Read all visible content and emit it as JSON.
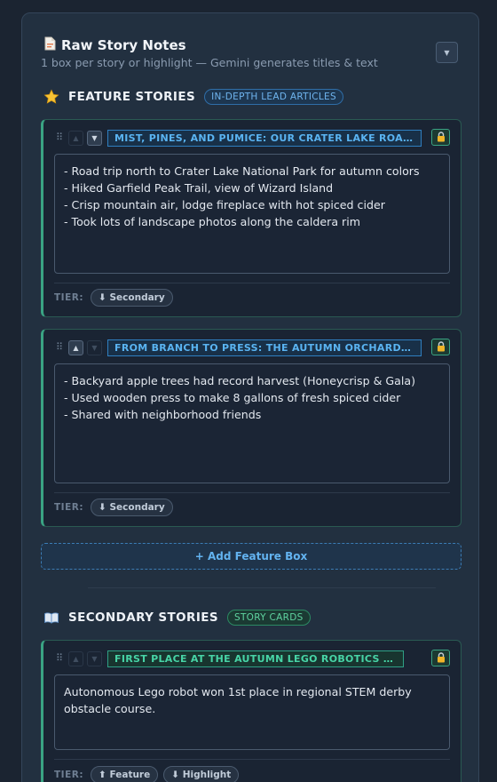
{
  "panel": {
    "title": "Raw Story Notes",
    "subtitle": "1 box per story or highlight — Gemini generates titles & text",
    "icon": "document-icon"
  },
  "feature_section": {
    "icon": "star-icon",
    "title": "FEATURE STORIES",
    "badge": "IN-DEPTH LEAD ARTICLES",
    "cards": [
      {
        "title": "MIST, PINES, AND PUMICE: OUR CRATER LAKE ROAD TRIP",
        "notes": "- Road trip north to Crater Lake National Park for autumn colors\n- Hiked Garfield Peak Trail, view of Wizard Island\n- Crisp mountain air, lodge fireplace with hot spiced cider\n- Took lots of landscape photos along the caldera rim",
        "tier_label": "TIER:",
        "tier_options": [
          "⬇ Secondary"
        ]
      },
      {
        "title": "FROM BRANCH TO PRESS: THE AUTUMN ORCHARD HAR…",
        "notes": "- Backyard apple trees had record harvest (Honeycrisp & Gala)\n- Used wooden press to make 8 gallons of fresh spiced cider\n- Shared with neighborhood friends",
        "tier_label": "TIER:",
        "tier_options": [
          "⬇ Secondary"
        ]
      }
    ],
    "add_button": "+ Add Feature Box"
  },
  "secondary_section": {
    "icon": "book-icon",
    "title": "SECONDARY STORIES",
    "badge": "STORY CARDS",
    "cards": [
      {
        "title": "FIRST PLACE AT THE AUTUMN LEGO ROBOTICS DERBY",
        "notes": "Autonomous Lego robot won 1st place in regional STEM derby\nobstacle course.",
        "tier_label": "TIER:",
        "tier_options": [
          "⬆ Feature",
          "⬇ Highlight"
        ]
      }
    ]
  },
  "colors": {
    "accent_green": "#3aa383",
    "accent_blue": "#5ab4f2",
    "lock": "#f0b429"
  }
}
